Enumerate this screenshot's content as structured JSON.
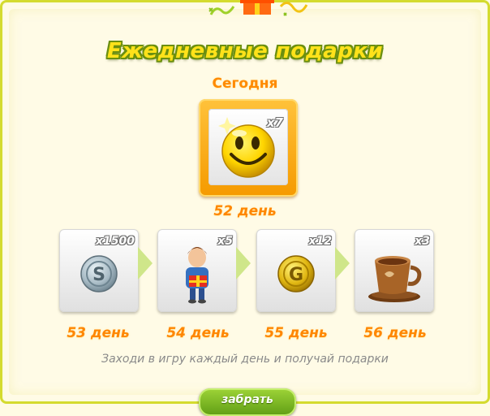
{
  "title": "Ежедневные подарки",
  "today": {
    "label": "Сегодня",
    "icon": "smiley-icon",
    "count": "x7",
    "day": "52 день"
  },
  "rewards": [
    {
      "icon": "silver-coin-icon",
      "count": "x1500",
      "day": "53 день"
    },
    {
      "icon": "boy-with-gift-icon",
      "count": "x5",
      "day": "54 день"
    },
    {
      "icon": "gold-coin-icon",
      "count": "x12",
      "day": "55 день"
    },
    {
      "icon": "coffee-cup-icon",
      "count": "x3",
      "day": "56 день"
    }
  ],
  "hint": "Заходи в игру каждый день и получай подарки",
  "button": {
    "label": "забрать"
  },
  "colors": {
    "accent_orange": "#ff8600",
    "title_yellow": "#ffe21a",
    "border_green": "#d4db2f",
    "button_green": "#7cbf1f"
  }
}
